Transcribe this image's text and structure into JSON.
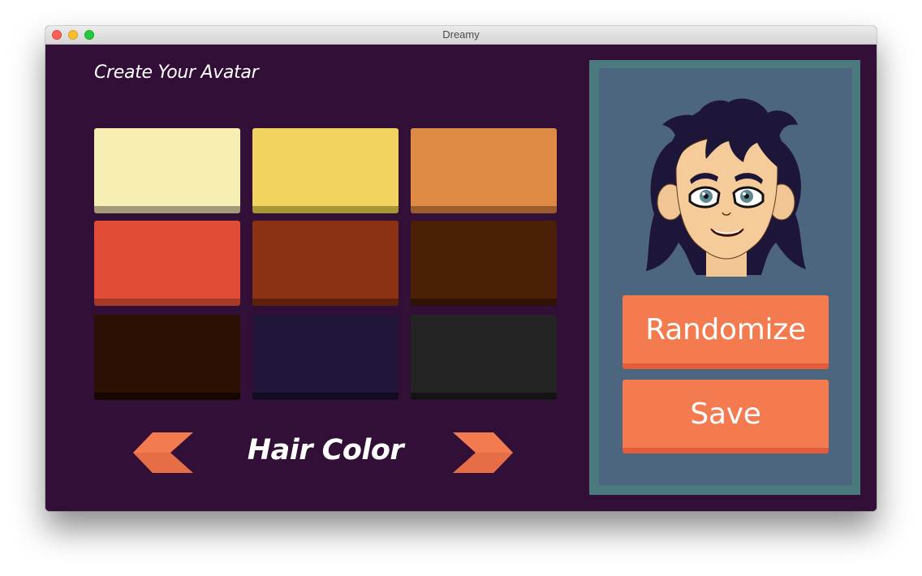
{
  "window": {
    "title": "Dreamy"
  },
  "editor": {
    "heading": "Create Your Avatar",
    "category": "Hair Color",
    "prev_icon": "chevron-left-icon",
    "next_icon": "chevron-right-icon",
    "swatches": [
      {
        "face": "#f7eeb4",
        "edge": "#a59a78"
      },
      {
        "face": "#f3d35f",
        "edge": "#a89536"
      },
      {
        "face": "#de8a45",
        "edge": "#9b5d2b"
      },
      {
        "face": "#e04c36",
        "edge": "#a53a28"
      },
      {
        "face": "#8a3213",
        "edge": "#5d210b"
      },
      {
        "face": "#4c2006",
        "edge": "#2f1203"
      },
      {
        "face": "#2c1003",
        "edge": "#150600"
      },
      {
        "face": "#22153a",
        "edge": "#120b22"
      },
      {
        "face": "#232323",
        "edge": "#141414"
      }
    ]
  },
  "preview": {
    "avatar_icon": "avatar-icon",
    "randomize_label": "Randomize",
    "save_label": "Save"
  },
  "colors": {
    "background": "#310f36",
    "accent": "#f47b4f",
    "panel_border": "#4a7a7e",
    "panel_fill": "#4c6680"
  }
}
